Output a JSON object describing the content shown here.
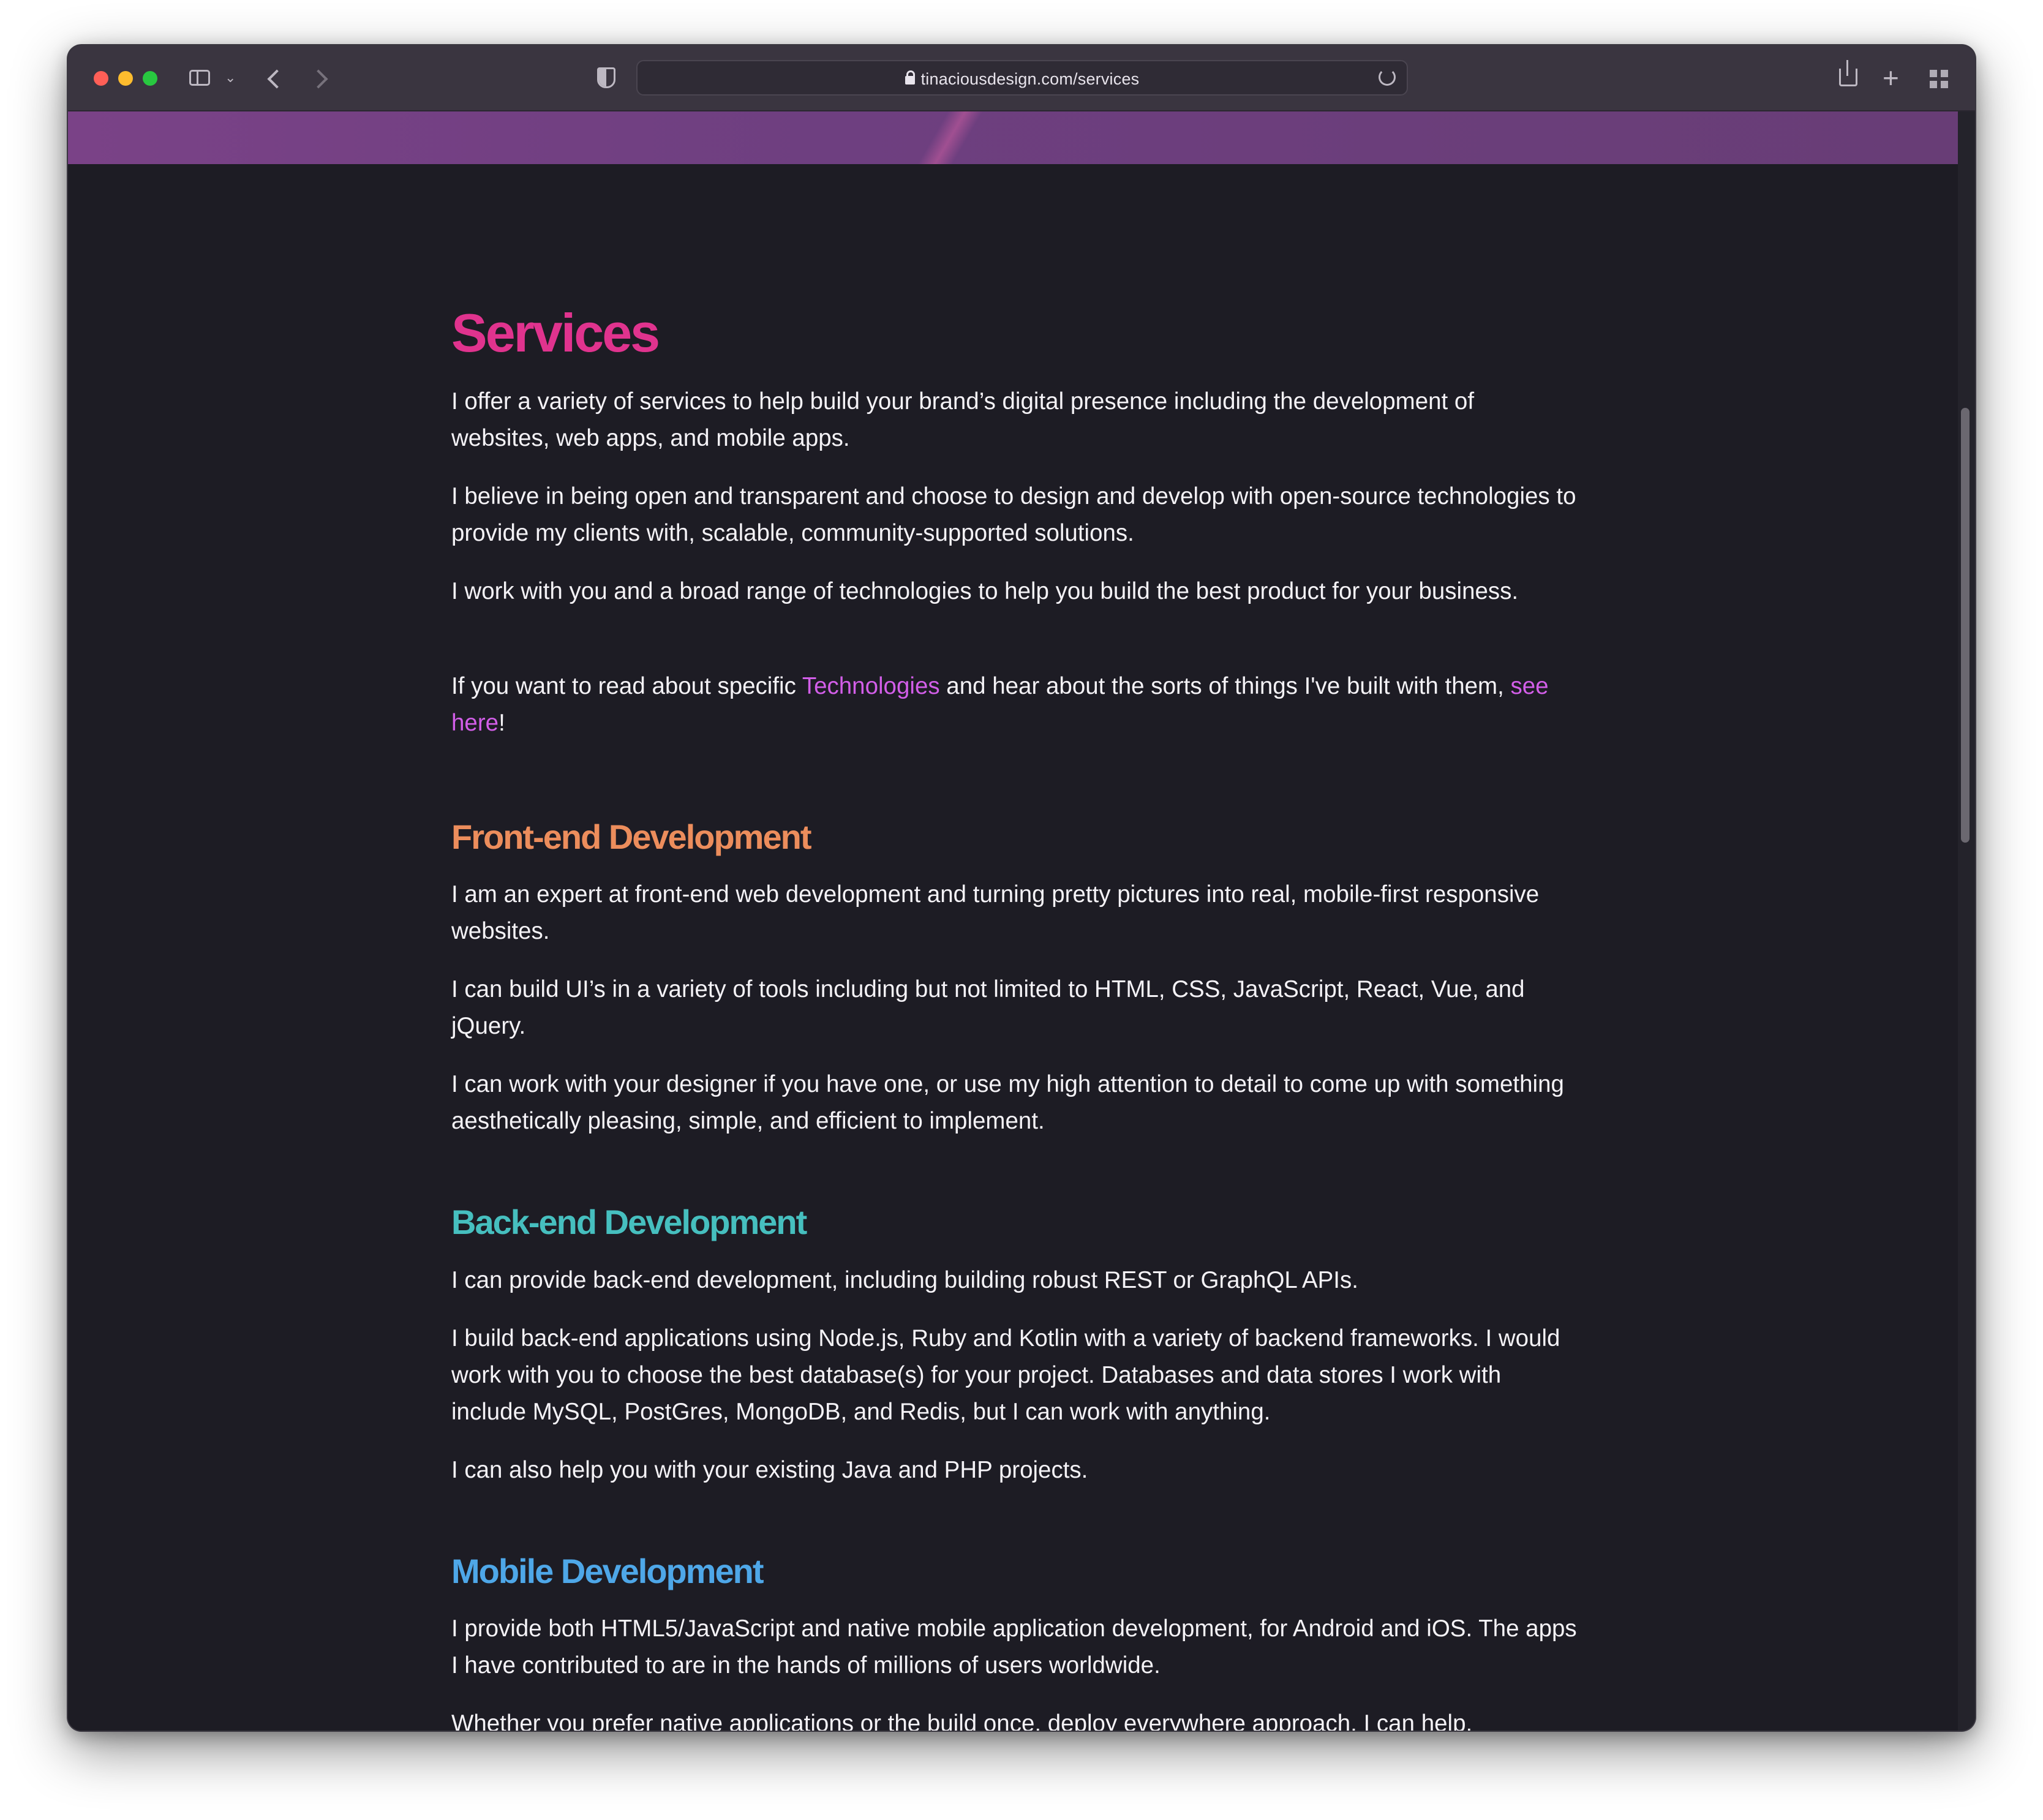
{
  "browser": {
    "url": "tinaciousdesign.com/services"
  },
  "page": {
    "title": "Services",
    "intro": [
      "I offer a variety of services to help build your brand’s digital presence including the development of websites, web apps, and mobile apps.",
      "I believe in being open and transparent and choose to design and develop with open-source technologies to provide my clients with, scalable, community-supported solutions.",
      "I work with you and a broad range of technologies to help you build the best product for your business."
    ],
    "links_paragraph": {
      "prefix": "If you want to read about specific ",
      "technologies_link": "Technologies",
      "middle": " and hear about the sorts of things I've built with them, ",
      "see_here_link": "see here",
      "suffix": "!"
    },
    "sections": [
      {
        "heading": "Front-end Development",
        "color": "#ec8d5c",
        "paragraphs": [
          "I am an expert at front-end web development and turning pretty pictures into real, mobile-first responsive websites.",
          "I can build UI’s in a variety of tools including but not limited to HTML, CSS, JavaScript, React, Vue, and jQuery.",
          "I can work with your designer if you have one, or use my high attention to detail to come up with something aesthetically pleasing, simple, and efficient to implement."
        ]
      },
      {
        "heading": "Back-end Development",
        "color": "#46bfbf",
        "paragraphs": [
          "I can provide back-end development, including building robust REST or GraphQL APIs.",
          "I build back-end applications using Node.js, Ruby and Kotlin with a variety of backend frameworks. I would work with you to choose the best database(s) for your project. Databases and data stores I work with include MySQL, PostGres, MongoDB, and Redis, but I can work with anything.",
          "I can also help you with your existing Java and PHP projects."
        ]
      },
      {
        "heading": "Mobile Development",
        "color": "#4ea7e8",
        "paragraphs": [
          "I provide both HTML5/JavaScript and native mobile application development, for Android and iOS. The apps I have contributed to are in the hands of millions of users worldwide.",
          "Whether you prefer native applications or the build once, deploy everywhere approach, I can help."
        ]
      }
    ]
  },
  "colors": {
    "title": "#e0338e",
    "link": "#d25ee8",
    "background": "#1d1c24",
    "banner": "#6e3f80"
  }
}
